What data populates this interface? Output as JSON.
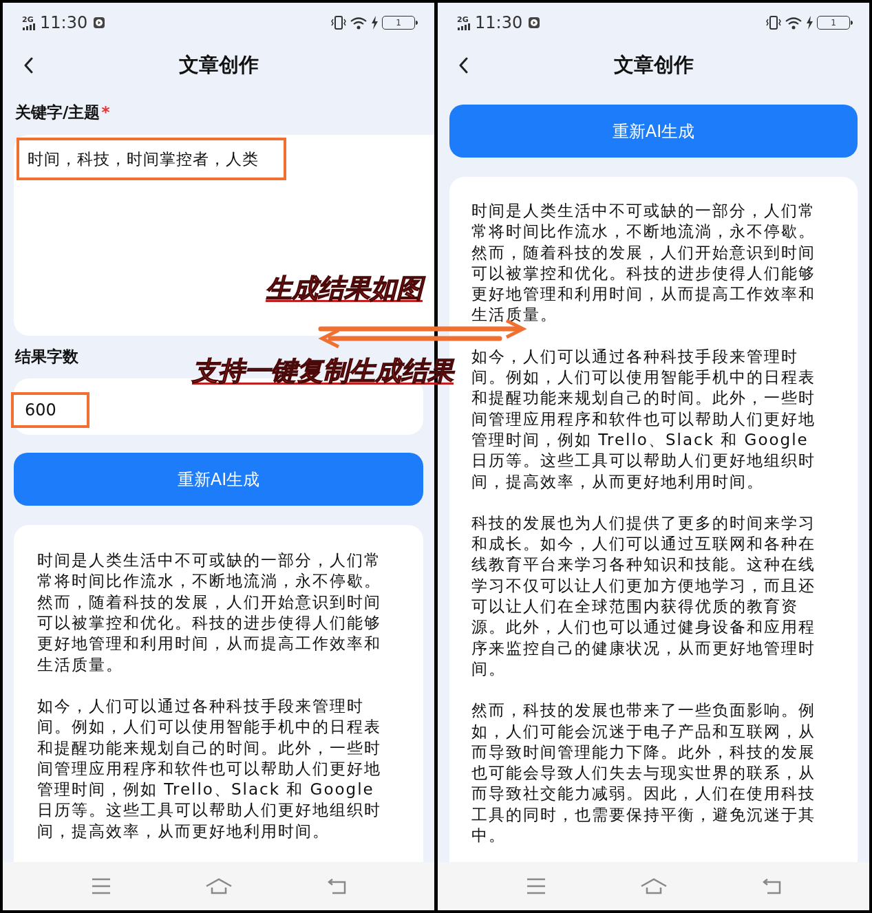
{
  "screens": [
    {
      "status_bar": {
        "network": "2G",
        "time": "11:30",
        "battery": "1"
      },
      "title": "文章创作",
      "keyword_label": "关键字/主题",
      "required_mark": "*",
      "keyword_value": "时间，科技，时间掌控者，人类",
      "count_label": "结果字数",
      "count_value": "600",
      "button": "重新AI生成",
      "paragraphs": [
        "时间是人类生活中不可或缺的一部分，人们常常将时间比作流水，不断地流淌，永不停歇。然而，随着科技的发展，人们开始意识到时间可以被掌控和优化。科技的进步使得人们能够更好地管理和利用时间，从而提高工作效率和生活质量。",
        "如今，人们可以通过各种科技手段来管理时间。例如，人们可以使用智能手机中的日程表和提醒功能来规划自己的时间。此外，一些时间管理应用程序和软件也可以帮助人们更好地管理时间，例如 Trello、Slack 和 Google 日历等。这些工具可以帮助人们更好地组织时间，提高效率，从而更好地利用时间。"
      ]
    },
    {
      "status_bar": {
        "network": "2G",
        "time": "11:30",
        "battery": "1"
      },
      "title": "文章创作",
      "button": "重新AI生成",
      "paragraphs": [
        "时间是人类生活中不可或缺的一部分，人们常常将时间比作流水，不断地流淌，永不停歇。然而，随着科技的发展，人们开始意识到时间可以被掌控和优化。科技的进步使得人们能够更好地管理和利用时间，从而提高工作效率和生活质量。",
        "如今，人们可以通过各种科技手段来管理时间。例如，人们可以使用智能手机中的日程表和提醒功能来规划自己的时间。此外，一些时间管理应用程序和软件也可以帮助人们更好地管理时间，例如 Trello、Slack 和 Google 日历等。这些工具可以帮助人们更好地组织时间，提高效率，从而更好地利用时间。",
        "科技的发展也为人们提供了更多的时间来学习和成长。如今，人们可以通过互联网和各种在线教育平台来学习各种知识和技能。这种在线学习不仅可以让人们更加方便地学习，而且还可以让人们在全球范围内获得优质的教育资源。此外，人们也可以通过健身设备和应用程序来监控自己的健康状况，从而更好地管理时间。",
        "然而，科技的发展也带来了一些负面影响。例如，人们可能会沉迷于电子产品和互联网，从而导致时间管理能力下降。此外，科技的发展也可能会导致人们失去与现实世界的联系，从而导致社交能力减弱。因此，人们在使用科技工具的同时，也需要保持平衡，避免沉迷于其中。"
      ]
    }
  ],
  "annotations": [
    {
      "text": "生成结果如图"
    },
    {
      "text": "支持一键复制生成结果"
    }
  ]
}
